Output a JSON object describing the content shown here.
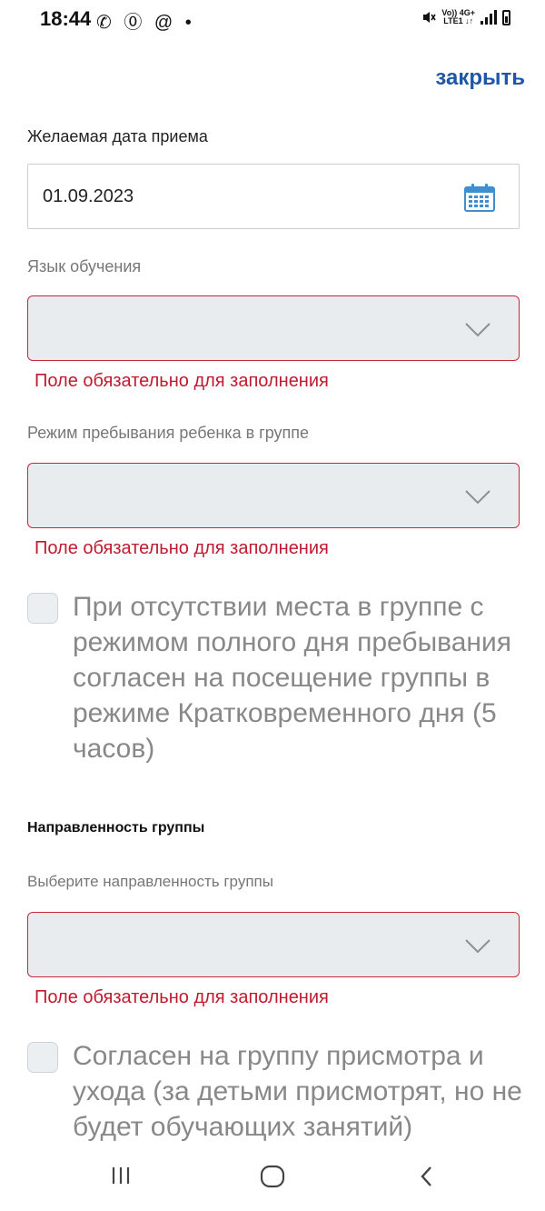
{
  "status_bar": {
    "time": "18:44",
    "left_icons": "✆ ⓪ @ •",
    "volte": "Vo)) 4G+",
    "lte": "LTE1 ↓↑"
  },
  "header": {
    "close_label": "закрыть"
  },
  "date_field": {
    "label": "Желаемая дата приема",
    "value": "01.09.2023",
    "icon": "calendar-icon"
  },
  "language_field": {
    "label": "Язык обучения",
    "value": "",
    "error": "Поле обязательно для заполнения",
    "icon": "chevron-down-icon"
  },
  "mode_field": {
    "label": "Режим пребывания ребенка в группе",
    "value": "",
    "error": "Поле обязательно для заполнения",
    "icon": "chevron-down-icon"
  },
  "short_day_checkbox": {
    "text": "При отсутствии места в группе с режимом полного дня пребывания согласен на посещение группы в режиме Кратковременного дня (5 часов)",
    "checked": false
  },
  "focus_section": {
    "title": "Направленность группы",
    "label": "Выберите направленность группы",
    "value": "",
    "error": "Поле обязательно для заполнения",
    "icon": "chevron-down-icon"
  },
  "care_checkbox": {
    "text": "Согласен на группу присмотра и ухода (за детьми присмотрят, но не будет обучающих занятий)",
    "checked": false
  },
  "colors": {
    "accent": "#1f57a8",
    "error": "#c01a2e",
    "select_bg": "#e9ecef",
    "select_border": "#c9283c"
  },
  "nav": {
    "icons": [
      "recent-apps-icon",
      "home-icon",
      "back-icon"
    ]
  }
}
